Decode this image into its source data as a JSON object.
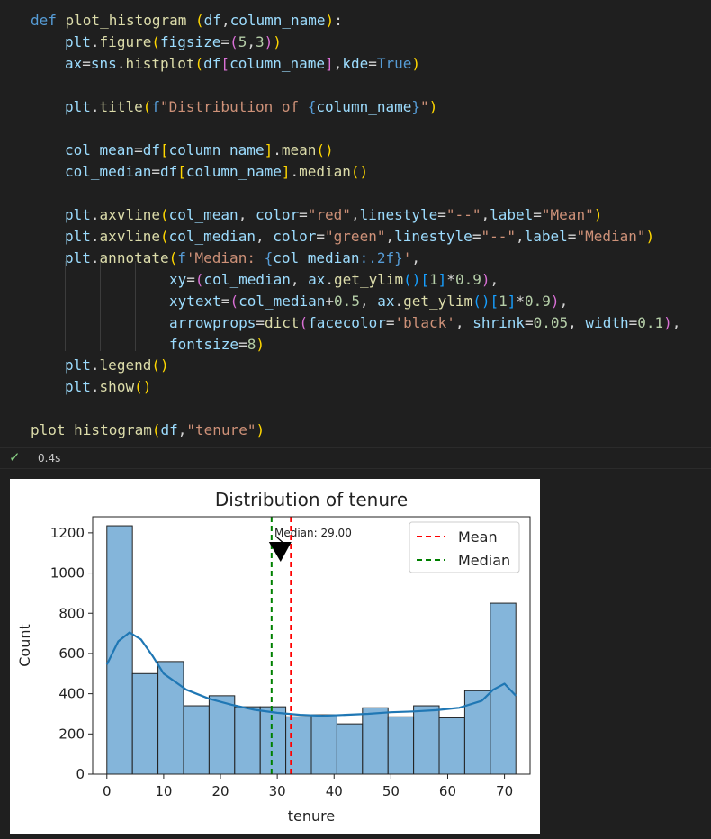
{
  "code_lines": [
    [
      [
        "kw",
        "def "
      ],
      [
        "fn",
        "plot_histogram "
      ],
      [
        "b1",
        "("
      ],
      [
        "var",
        "df"
      ],
      [
        "txt",
        ","
      ],
      [
        "var",
        "column_name"
      ],
      [
        "b1",
        ")"
      ],
      [
        "txt",
        ":"
      ]
    ],
    [
      [
        "var",
        "plt"
      ],
      [
        "txt",
        "."
      ],
      [
        "fn",
        "figure"
      ],
      [
        "b1",
        "("
      ],
      [
        "var",
        "figsize"
      ],
      [
        "txt",
        "="
      ],
      [
        "b2",
        "("
      ],
      [
        "num",
        "5"
      ],
      [
        "txt",
        ","
      ],
      [
        "num",
        "3"
      ],
      [
        "b2",
        ")"
      ],
      [
        "b1",
        ")"
      ]
    ],
    [
      [
        "var",
        "ax"
      ],
      [
        "txt",
        "="
      ],
      [
        "var",
        "sns"
      ],
      [
        "txt",
        "."
      ],
      [
        "fn",
        "histplot"
      ],
      [
        "b1",
        "("
      ],
      [
        "var",
        "df"
      ],
      [
        "b2",
        "["
      ],
      [
        "var",
        "column_name"
      ],
      [
        "b2",
        "]"
      ],
      [
        "txt",
        ","
      ],
      [
        "var",
        "kde"
      ],
      [
        "txt",
        "="
      ],
      [
        "kw",
        "True"
      ],
      [
        "b1",
        ")"
      ]
    ],
    [],
    [
      [
        "var",
        "plt"
      ],
      [
        "txt",
        "."
      ],
      [
        "fn",
        "title"
      ],
      [
        "b1",
        "("
      ],
      [
        "kw",
        "f"
      ],
      [
        "str",
        "\"Distribution of "
      ],
      [
        "kw",
        "{"
      ],
      [
        "var",
        "column_name"
      ],
      [
        "kw",
        "}"
      ],
      [
        "str",
        "\""
      ],
      [
        "b1",
        ")"
      ]
    ],
    [],
    [
      [
        "var",
        "col_mean"
      ],
      [
        "txt",
        "="
      ],
      [
        "var",
        "df"
      ],
      [
        "b1",
        "["
      ],
      [
        "var",
        "column_name"
      ],
      [
        "b1",
        "]"
      ],
      [
        "txt",
        "."
      ],
      [
        "fn",
        "mean"
      ],
      [
        "b1",
        "()"
      ]
    ],
    [
      [
        "var",
        "col_median"
      ],
      [
        "txt",
        "="
      ],
      [
        "var",
        "df"
      ],
      [
        "b1",
        "["
      ],
      [
        "var",
        "column_name"
      ],
      [
        "b1",
        "]"
      ],
      [
        "txt",
        "."
      ],
      [
        "fn",
        "median"
      ],
      [
        "b1",
        "()"
      ]
    ],
    [],
    [
      [
        "var",
        "plt"
      ],
      [
        "txt",
        "."
      ],
      [
        "fn",
        "axvline"
      ],
      [
        "b1",
        "("
      ],
      [
        "var",
        "col_mean"
      ],
      [
        "txt",
        ", "
      ],
      [
        "var",
        "color"
      ],
      [
        "txt",
        "="
      ],
      [
        "str",
        "\"red\""
      ],
      [
        "txt",
        ","
      ],
      [
        "var",
        "linestyle"
      ],
      [
        "txt",
        "="
      ],
      [
        "str",
        "\"--\""
      ],
      [
        "txt",
        ","
      ],
      [
        "var",
        "label"
      ],
      [
        "txt",
        "="
      ],
      [
        "str",
        "\"Mean\""
      ],
      [
        "b1",
        ")"
      ]
    ],
    [
      [
        "var",
        "plt"
      ],
      [
        "txt",
        "."
      ],
      [
        "fn",
        "axvline"
      ],
      [
        "b1",
        "("
      ],
      [
        "var",
        "col_median"
      ],
      [
        "txt",
        ", "
      ],
      [
        "var",
        "color"
      ],
      [
        "txt",
        "="
      ],
      [
        "str",
        "\"green\""
      ],
      [
        "txt",
        ","
      ],
      [
        "var",
        "linestyle"
      ],
      [
        "txt",
        "="
      ],
      [
        "str",
        "\"--\""
      ],
      [
        "txt",
        ","
      ],
      [
        "var",
        "label"
      ],
      [
        "txt",
        "="
      ],
      [
        "str",
        "\"Median\""
      ],
      [
        "b1",
        ")"
      ]
    ],
    [
      [
        "var",
        "plt"
      ],
      [
        "txt",
        "."
      ],
      [
        "fn",
        "annotate"
      ],
      [
        "b1",
        "("
      ],
      [
        "kw",
        "f"
      ],
      [
        "str",
        "'Median: "
      ],
      [
        "kw",
        "{"
      ],
      [
        "var",
        "col_median"
      ],
      [
        "kw",
        ":.2f}"
      ],
      [
        "str",
        "'"
      ],
      [
        "txt",
        ","
      ]
    ],
    [
      [
        "var",
        "xy"
      ],
      [
        "txt",
        "="
      ],
      [
        "b2",
        "("
      ],
      [
        "var",
        "col_median"
      ],
      [
        "txt",
        ", "
      ],
      [
        "var",
        "ax"
      ],
      [
        "txt",
        "."
      ],
      [
        "fn",
        "get_ylim"
      ],
      [
        "b3",
        "()"
      ],
      [
        "b3",
        "["
      ],
      [
        "num",
        "1"
      ],
      [
        "b3",
        "]"
      ],
      [
        "txt",
        "*"
      ],
      [
        "num",
        "0.9"
      ],
      [
        "b2",
        ")"
      ],
      [
        "txt",
        ","
      ]
    ],
    [
      [
        "var",
        "xytext"
      ],
      [
        "txt",
        "="
      ],
      [
        "b2",
        "("
      ],
      [
        "var",
        "col_median"
      ],
      [
        "txt",
        "+"
      ],
      [
        "num",
        "0.5"
      ],
      [
        "txt",
        ", "
      ],
      [
        "var",
        "ax"
      ],
      [
        "txt",
        "."
      ],
      [
        "fn",
        "get_ylim"
      ],
      [
        "b3",
        "()"
      ],
      [
        "b3",
        "["
      ],
      [
        "num",
        "1"
      ],
      [
        "b3",
        "]"
      ],
      [
        "txt",
        "*"
      ],
      [
        "num",
        "0.9"
      ],
      [
        "b2",
        ")"
      ],
      [
        "txt",
        ","
      ]
    ],
    [
      [
        "var",
        "arrowprops"
      ],
      [
        "txt",
        "="
      ],
      [
        "fn",
        "dict"
      ],
      [
        "b2",
        "("
      ],
      [
        "var",
        "facecolor"
      ],
      [
        "txt",
        "="
      ],
      [
        "str",
        "'black'"
      ],
      [
        "txt",
        ", "
      ],
      [
        "var",
        "shrink"
      ],
      [
        "txt",
        "="
      ],
      [
        "num",
        "0.05"
      ],
      [
        "txt",
        ", "
      ],
      [
        "var",
        "width"
      ],
      [
        "txt",
        "="
      ],
      [
        "num",
        "0.1"
      ],
      [
        "b2",
        ")"
      ],
      [
        "txt",
        ","
      ]
    ],
    [
      [
        "var",
        "fontsize"
      ],
      [
        "txt",
        "="
      ],
      [
        "num",
        "8"
      ],
      [
        "b1",
        ")"
      ]
    ],
    [
      [
        "var",
        "plt"
      ],
      [
        "txt",
        "."
      ],
      [
        "fn",
        "legend"
      ],
      [
        "b1",
        "()"
      ]
    ],
    [
      [
        "var",
        "plt"
      ],
      [
        "txt",
        "."
      ],
      [
        "fn",
        "show"
      ],
      [
        "b1",
        "()"
      ]
    ],
    [],
    [
      [
        "fn",
        "plot_histogram"
      ],
      [
        "b1",
        "("
      ],
      [
        "var",
        "df"
      ],
      [
        "txt",
        ","
      ],
      [
        "str",
        "\"tenure\""
      ],
      [
        "b1",
        ")"
      ]
    ]
  ],
  "status": {
    "check_icon": "check-icon",
    "time": "0.4s"
  },
  "chart_data": {
    "type": "bar",
    "title": "Distribution of tenure",
    "xlabel": "tenure",
    "ylabel": "Count",
    "xlim": [
      -2.5,
      74.5
    ],
    "ylim": [
      0,
      1280
    ],
    "xticks": [
      0,
      10,
      20,
      30,
      40,
      50,
      60,
      70
    ],
    "yticks": [
      0,
      200,
      400,
      600,
      800,
      1000,
      1200
    ],
    "bin_edges": [
      0,
      5,
      9,
      14,
      19,
      24,
      28,
      33,
      38,
      43,
      48,
      52,
      57,
      62,
      67,
      72
    ],
    "counts": [
      1235,
      500,
      560,
      340,
      390,
      335,
      335,
      285,
      295,
      250,
      330,
      285,
      340,
      280,
      415
    ],
    "counts_last": 850,
    "kde_x": [
      0,
      2,
      4,
      6,
      8,
      10,
      14,
      18,
      22,
      26,
      30,
      34,
      38,
      42,
      46,
      50,
      54,
      58,
      62,
      66,
      68,
      70,
      72
    ],
    "kde_y": [
      545,
      660,
      705,
      670,
      590,
      500,
      420,
      375,
      345,
      320,
      305,
      295,
      290,
      295,
      300,
      308,
      312,
      318,
      330,
      365,
      420,
      450,
      390
    ],
    "mean": 32.4,
    "median": 29.0,
    "annotation": "Median: 29.00",
    "annotation_xy": [
      29.0,
      1152
    ],
    "annotation_xytext": [
      29.5,
      1152
    ],
    "legend_position": "top-right",
    "series": [
      {
        "name": "Mean",
        "color": "#ff0000",
        "style": "dashed"
      },
      {
        "name": "Median",
        "color": "#008000",
        "style": "dashed"
      }
    ],
    "bar_color": "#6fa8d4",
    "kde_color": "#1f77b4"
  }
}
